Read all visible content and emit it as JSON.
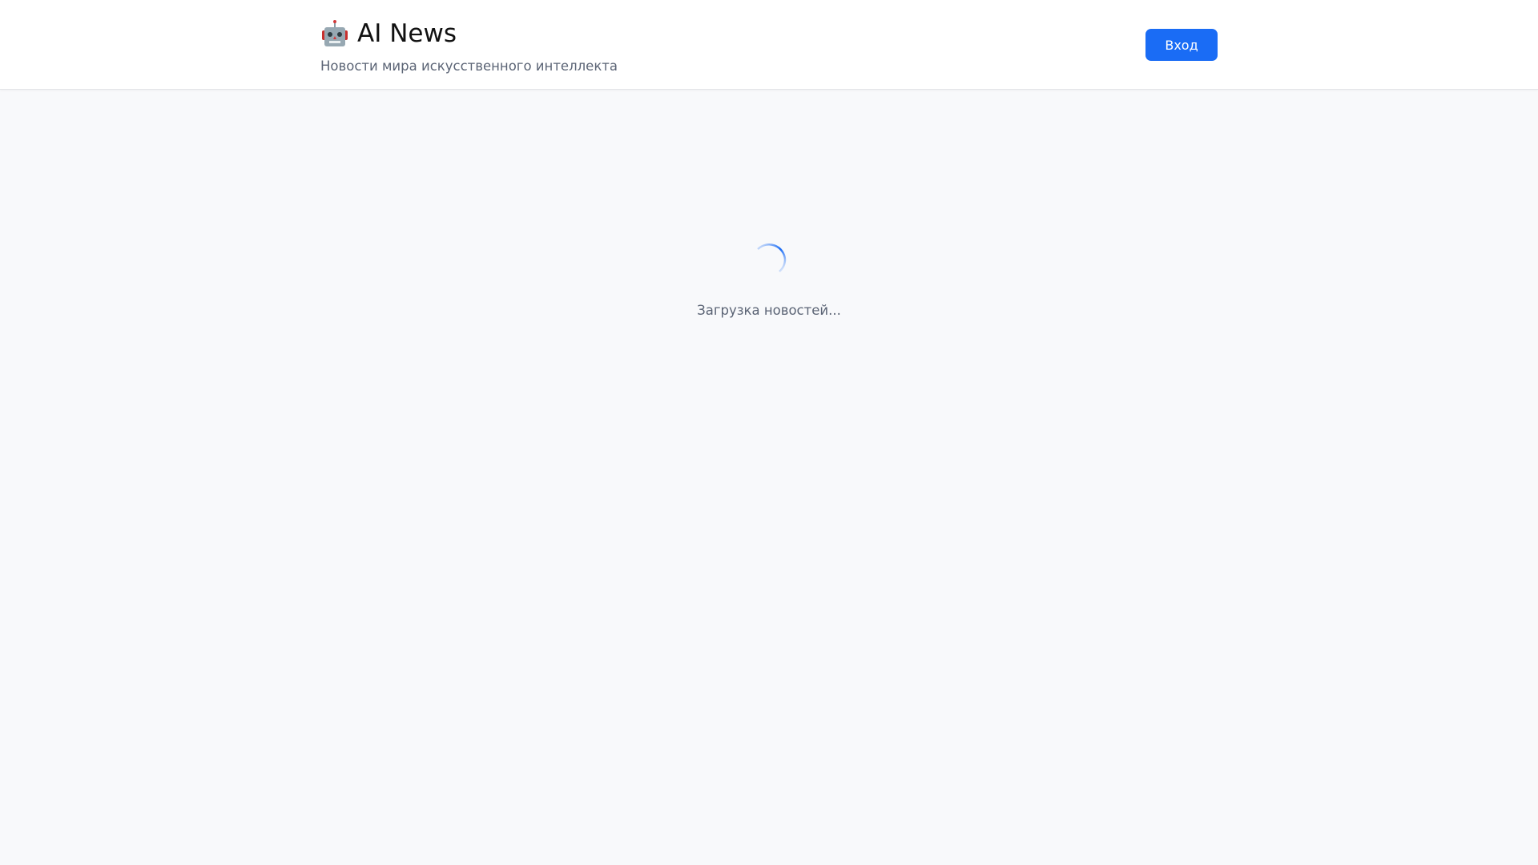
{
  "header": {
    "logo_icon": "robot-icon",
    "title": "AI News",
    "subtitle": "Новости мира искусственного интеллекта",
    "login_label": "Вход"
  },
  "main": {
    "loading_text": "Загрузка новостей..."
  },
  "colors": {
    "accent": "#1a6cf5",
    "muted_text": "#5b6475"
  }
}
